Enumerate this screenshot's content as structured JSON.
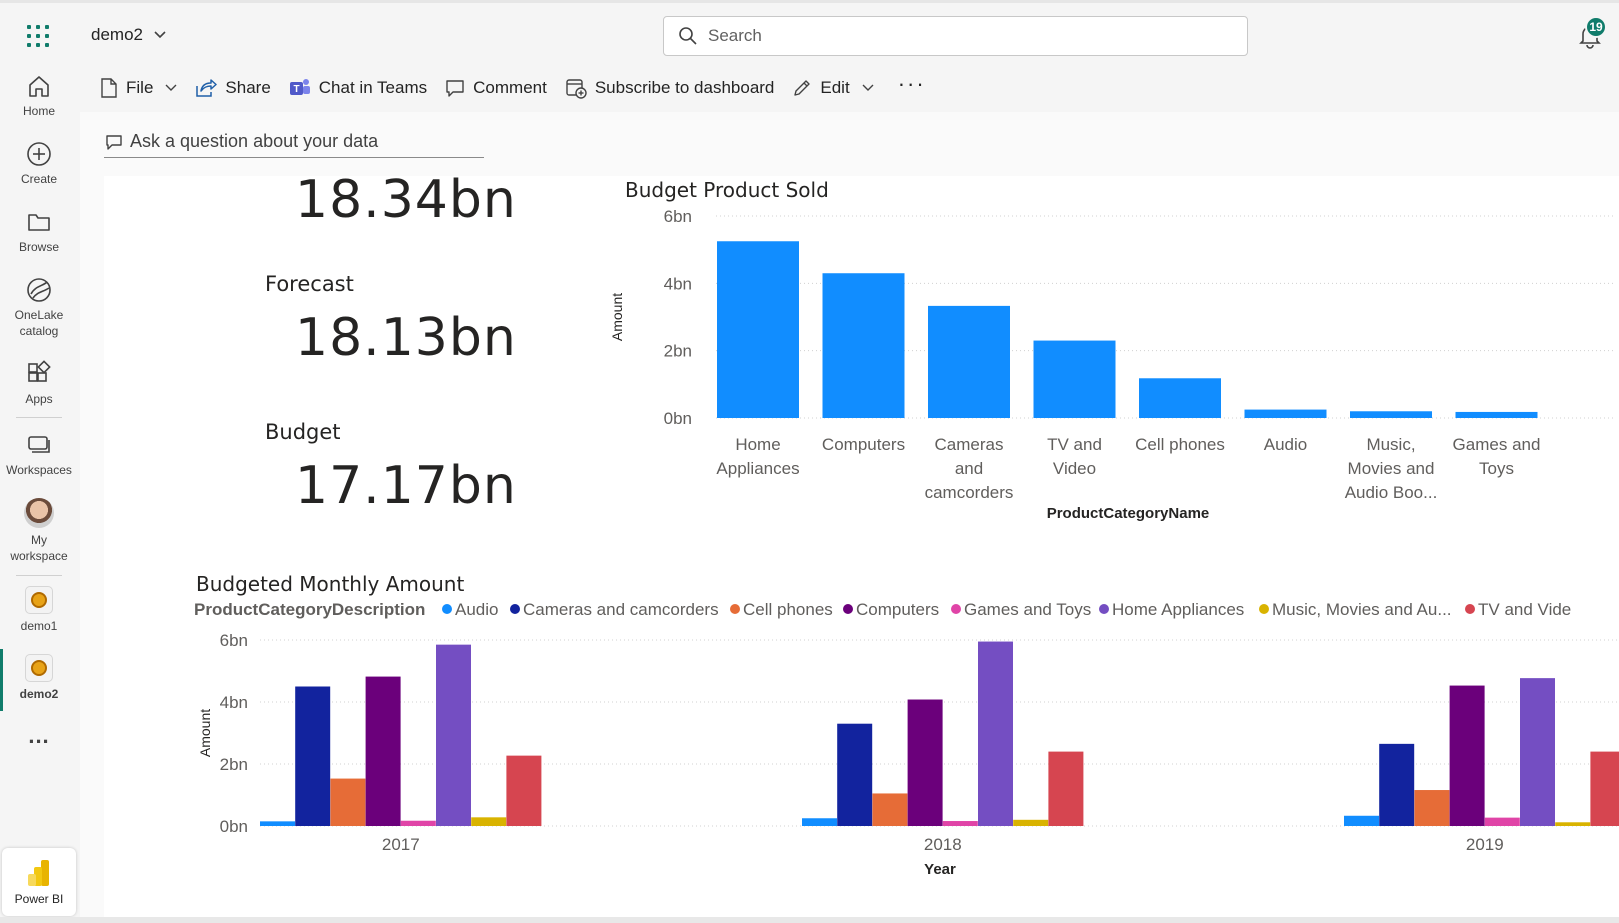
{
  "topbar": {
    "workspace_name": "demo2",
    "search_placeholder": "Search",
    "notification_count": "19"
  },
  "nav": {
    "items": [
      {
        "label": "Home"
      },
      {
        "label": "Create"
      },
      {
        "label": "Browse"
      },
      {
        "label": "OneLake catalog"
      },
      {
        "label": "Apps"
      },
      {
        "label": "Workspaces"
      },
      {
        "label": "My workspace"
      },
      {
        "label": "demo1"
      },
      {
        "label": "demo2"
      }
    ],
    "more": "...",
    "powerbi_label": "Power BI"
  },
  "commands": {
    "file": "File",
    "share": "Share",
    "chat": "Chat in Teams",
    "comment": "Comment",
    "subscribe": "Subscribe to dashboard",
    "edit": "Edit",
    "more": "···"
  },
  "qna": {
    "placeholder": "Ask a question about your data"
  },
  "kpis": {
    "top_value": "18.34bn",
    "forecast_label": "Forecast",
    "forecast_value": "18.13bn",
    "budget_label": "Budget",
    "budget_value": "17.17bn"
  },
  "colors": {
    "accent": "#107c6b",
    "audio": "#118dff",
    "cameras": "#12239e",
    "cell": "#e66c37",
    "computers": "#6b007b",
    "games": "#e044a7",
    "home": "#744ec2",
    "music": "#d9b300",
    "tv": "#d64550"
  },
  "chart_data": [
    {
      "type": "bar",
      "title": "Budget Product Sold",
      "xlabel": "ProductCategoryName",
      "ylabel": "Amount",
      "ylim": [
        0,
        6
      ],
      "yticks": [
        "0bn",
        "2bn",
        "4bn",
        "6bn"
      ],
      "categories": [
        "Home Appliances",
        "Computers",
        "Cameras and camcorders",
        "TV and Video",
        "Cell phones",
        "Audio",
        "Music, Movies and Audio Boo...",
        "Games and Toys"
      ],
      "category_lines": [
        [
          "Home",
          "Appliances"
        ],
        [
          "Computers"
        ],
        [
          "Cameras",
          "and",
          "camcorders"
        ],
        [
          "TV and",
          "Video"
        ],
        [
          "Cell phones"
        ],
        [
          "Audio"
        ],
        [
          "Music,",
          "Movies and",
          "Audio Boo..."
        ],
        [
          "Games and",
          "Toys"
        ]
      ],
      "values": [
        5.25,
        4.3,
        3.33,
        2.3,
        1.18,
        0.25,
        0.2,
        0.18
      ],
      "color": "#118dff"
    },
    {
      "type": "bar",
      "title": "Budgeted Monthly Amount",
      "legend_title": "ProductCategoryDescription",
      "legend": [
        "Audio",
        "Cameras and camcorders",
        "Cell phones",
        "Computers",
        "Games and Toys",
        "Home Appliances",
        "Music, Movies and Au...",
        "TV and Vide"
      ],
      "xlabel": "Year",
      "ylabel": "Amount",
      "ylim": [
        0,
        6
      ],
      "yticks": [
        "0bn",
        "2bn",
        "4bn",
        "6bn"
      ],
      "categories": [
        "2017",
        "2018",
        "2019"
      ],
      "series": [
        {
          "name": "Audio",
          "color": "#118dff",
          "values": [
            0.15,
            0.25,
            0.33
          ]
        },
        {
          "name": "Cameras and camcorders",
          "color": "#12239e",
          "values": [
            4.5,
            3.3,
            2.65
          ]
        },
        {
          "name": "Cell phones",
          "color": "#e66c37",
          "values": [
            1.53,
            1.05,
            1.16
          ]
        },
        {
          "name": "Computers",
          "color": "#6b007b",
          "values": [
            4.82,
            4.08,
            4.53
          ]
        },
        {
          "name": "Games and Toys",
          "color": "#e044a7",
          "values": [
            0.17,
            0.16,
            0.27
          ]
        },
        {
          "name": "Home Appliances",
          "color": "#744ec2",
          "values": [
            5.85,
            5.95,
            4.77
          ]
        },
        {
          "name": "Music, Movies and Au...",
          "color": "#d9b300",
          "values": [
            0.28,
            0.2,
            0.12
          ]
        },
        {
          "name": "TV and Vide",
          "color": "#d64550",
          "values": [
            2.27,
            2.4,
            2.4
          ]
        }
      ]
    }
  ]
}
